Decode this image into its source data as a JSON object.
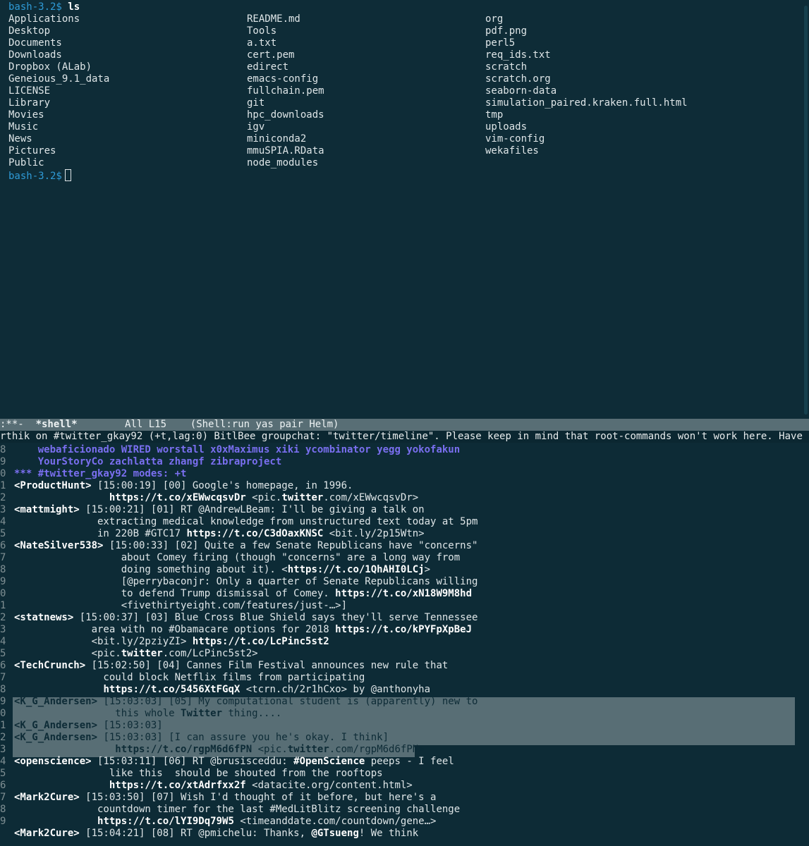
{
  "terminal": {
    "prompt": "bash-3.2$",
    "command": "ls",
    "ls_columns": [
      [
        "Applications",
        "Desktop",
        "Documents",
        "Downloads",
        "Dropbox (ALab)",
        "Geneious_9.1_data",
        "LICENSE",
        "Library",
        "Movies",
        "Music",
        "News",
        "Pictures",
        "Public"
      ],
      [
        "README.md",
        "Tools",
        "a.txt",
        "cert.pem",
        "edirect",
        "emacs-config",
        "fullchain.pem",
        "git",
        "hpc_downloads",
        "igv",
        "miniconda2",
        "mmuSPIA.RData",
        "node_modules"
      ],
      [
        "org",
        "pdf.png",
        "perl5",
        "req_ids.txt",
        "scratch",
        "scratch.org",
        "seaborn-data",
        "simulation_paired.kraken.full.html",
        "tmp",
        "uploads",
        "vim-config",
        "wekafiles"
      ]
    ],
    "prompt2": "bash-3.2$"
  },
  "modeline": {
    "status": ":**-",
    "buffer": "*shell*",
    "position": "All L15",
    "modes": "(Shell:run yas pair Helm)"
  },
  "info_line": "rthik on #twitter_gkay92 (+t,lag:0) BitlBee groupchat: \"twitter/timeline\". Please keep in mind that root-commands won't work here. Have",
  "chat": {
    "line_numbers": [
      "8",
      "9",
      "0",
      "1",
      "2",
      "3",
      "4",
      "5",
      "6",
      "7",
      "8",
      "9",
      "0",
      "1",
      "2",
      "3",
      "4",
      "5",
      "6",
      "7",
      "8",
      "9",
      "0",
      "1",
      "2",
      "3",
      "4",
      "5",
      "6",
      "7",
      "8",
      "9"
    ],
    "names_line1": "webaficionado WIRED worstall x0xMaximus xiki ycombinator yegg yokofakun",
    "names_line2": "YourStoryCo zachlatta zhangf zibraproject",
    "modes_line": "*** #twitter_gkay92 modes: +t",
    "messages": [
      {
        "nick": "<ProductHunt>",
        "head": " [15:00:19] [00] Google's homepage, in 1996.",
        "cont": [
          {
            "pre": "                ",
            "url": "https://t.co/xEWwcqsvDr",
            "post": " <pic.",
            "url2": "twitter",
            "post2": ".com/xEWwcqsvDr>"
          }
        ]
      },
      {
        "nick": "<mattmight>",
        "head": " [15:00:21] [01] RT @AndrewLBeam: I'll be giving a talk on",
        "cont": [
          {
            "pre": "              extracting medical knowledge from unstructured text today at 5pm"
          },
          {
            "pre": "              in 220B #GTC17 ",
            "url": "https://t.co/C3dOaxKNSC",
            "post": " <bit.ly/2p15Wtn>"
          }
        ]
      },
      {
        "nick": "<NateSilver538>",
        "head": " [15:00:33] [02] Quite a few Senate Republicans have \"concerns\"",
        "cont": [
          {
            "pre": "                  about Comey firing (though \"concerns\" are a long way from"
          },
          {
            "pre": "                  doing something about it). <",
            "url": "https://t.co/1QhAHI0LCj",
            "post": ">"
          },
          {
            "pre": "                  [@perrybaconjr: Only a quarter of Senate Republicans willing"
          },
          {
            "pre": "                  to defend Trump dismissal of Comey. ",
            "url": "https://t.co/xN18W9M8hd"
          },
          {
            "pre": "                  <fivethirtyeight.com/features/just-…>]"
          }
        ]
      },
      {
        "nick": "<statnews>",
        "head": " [15:00:37] [03] Blue Cross Blue Shield says they'll serve Tennessee",
        "cont": [
          {
            "pre": "             area with no #Obamacare options for 2018 ",
            "url": "https://t.co/kPYFpXpBeJ"
          },
          {
            "pre": "             <bit.ly/2pziyZI> ",
            "url": "https://t.co/LcPinc5st2"
          },
          {
            "pre": "             <pic.",
            "url": "twitter",
            "post": ".com/LcPinc5st2>"
          }
        ]
      },
      {
        "nick": "<TechCrunch>",
        "head": " [15:02:50] [04] Cannes Film Festival announces new rule that",
        "cont": [
          {
            "pre": "               could block Netflix films from participating"
          },
          {
            "pre": "               ",
            "url": "https://t.co/5456XtFGqX",
            "post": " <tcrn.ch/2r1hCxo> by @anthonyha"
          }
        ]
      }
    ],
    "highlighted": [
      {
        "nick": "<K_G_Andersen>",
        "text": " [15:03:03] [05] My computational student is (apparently) new to"
      },
      {
        "nick": "",
        "text": "                 this whole ",
        "bold": "Twitter",
        "after": " thing...."
      },
      {
        "nick": "<K_G_Andersen>",
        "text": " [15:03:03]"
      },
      {
        "nick": "<K_G_Andersen>",
        "text": " [15:03:03] [I can assure you he's okay. I think]"
      },
      {
        "nick": "",
        "text": "                 ",
        "bold": "https://t.co/rgpM6d6fPN",
        "after": " <pic.",
        "bold2": "twitter",
        "after2": ".com/rgpM6d6fPN>"
      }
    ],
    "messages2": [
      {
        "nick": "<openscience>",
        "head": " [15:03:11] [06] RT @brusisceddu: ",
        "bold": "#OpenScience",
        "head2": " peeps - I feel",
        "cont": [
          {
            "pre": "                like this  should be shouted from the rooftops"
          },
          {
            "pre": "                ",
            "url": "https://t.co/xtAdrfxx2f",
            "post": " <datacite.org/content.html>"
          }
        ]
      },
      {
        "nick": "<Mark2Cure>",
        "head": " [15:03:50] [07] Wish I'd thought of it before, but here's a",
        "cont": [
          {
            "pre": "              countdown timer for the last #MedLitBlitz screening challenge"
          },
          {
            "pre": "              ",
            "url": "https://t.co/lYI9Dq79W5",
            "post": " <timeanddate.com/countdown/gene…>"
          }
        ]
      },
      {
        "nick": "<Mark2Cure>",
        "head": " [15:04:21] [08] RT @pmichelu: Thanks, ",
        "bold": "@GTsueng",
        "head2": "! We think",
        "cont": []
      }
    ]
  }
}
